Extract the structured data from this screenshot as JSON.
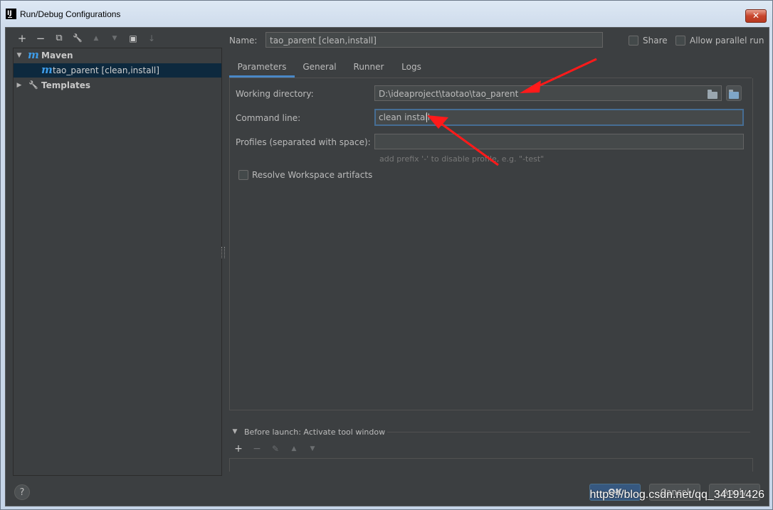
{
  "window": {
    "title": "Run/Debug Configurations",
    "app_icon_text": "IJ",
    "close_glyph": "✕"
  },
  "toolbar": {
    "add": "+",
    "remove": "−",
    "copy": "⧉",
    "edit_defaults": "🔧",
    "move_up": "▲",
    "move_down": "▼",
    "new_folder": "▣",
    "sort": "↓"
  },
  "tree": {
    "items": [
      {
        "label": "Maven",
        "expanded": true
      },
      {
        "label": "tao_parent [clean,install]",
        "selected": true
      },
      {
        "label": "Templates",
        "expanded": false
      }
    ]
  },
  "header": {
    "name_label": "Name:",
    "name_value": "tao_parent [clean,install]",
    "share_label": "Share",
    "parallel_label": "Allow parallel run"
  },
  "tabs": [
    {
      "label": "Parameters",
      "active": true
    },
    {
      "label": "General"
    },
    {
      "label": "Runner"
    },
    {
      "label": "Logs"
    }
  ],
  "params": {
    "working_dir_label": "Working directory:",
    "working_dir_value": "D:\\ideaproject\\taotao\\tao_parent",
    "command_line_label": "Command line:",
    "command_line_value": "clean install",
    "profiles_label": "Profiles (separated with space):",
    "profiles_value": "",
    "profiles_hint": "add prefix '-' to disable profile, e.g. \"-test\"",
    "resolve_label": "Resolve Workspace artifacts"
  },
  "before_launch": {
    "title": "Before launch: Activate tool window"
  },
  "footer": {
    "help": "?",
    "ok": "OK",
    "cancel": "Cancel",
    "apply": "Apply"
  },
  "watermark": "https://blog.csdn.net/qq_34191426",
  "colors": {
    "background": "#3c3f41",
    "field": "#45494a",
    "accent": "#4a88c7",
    "annotation": "#ff1a1a",
    "maven": "#3e9ce8"
  }
}
